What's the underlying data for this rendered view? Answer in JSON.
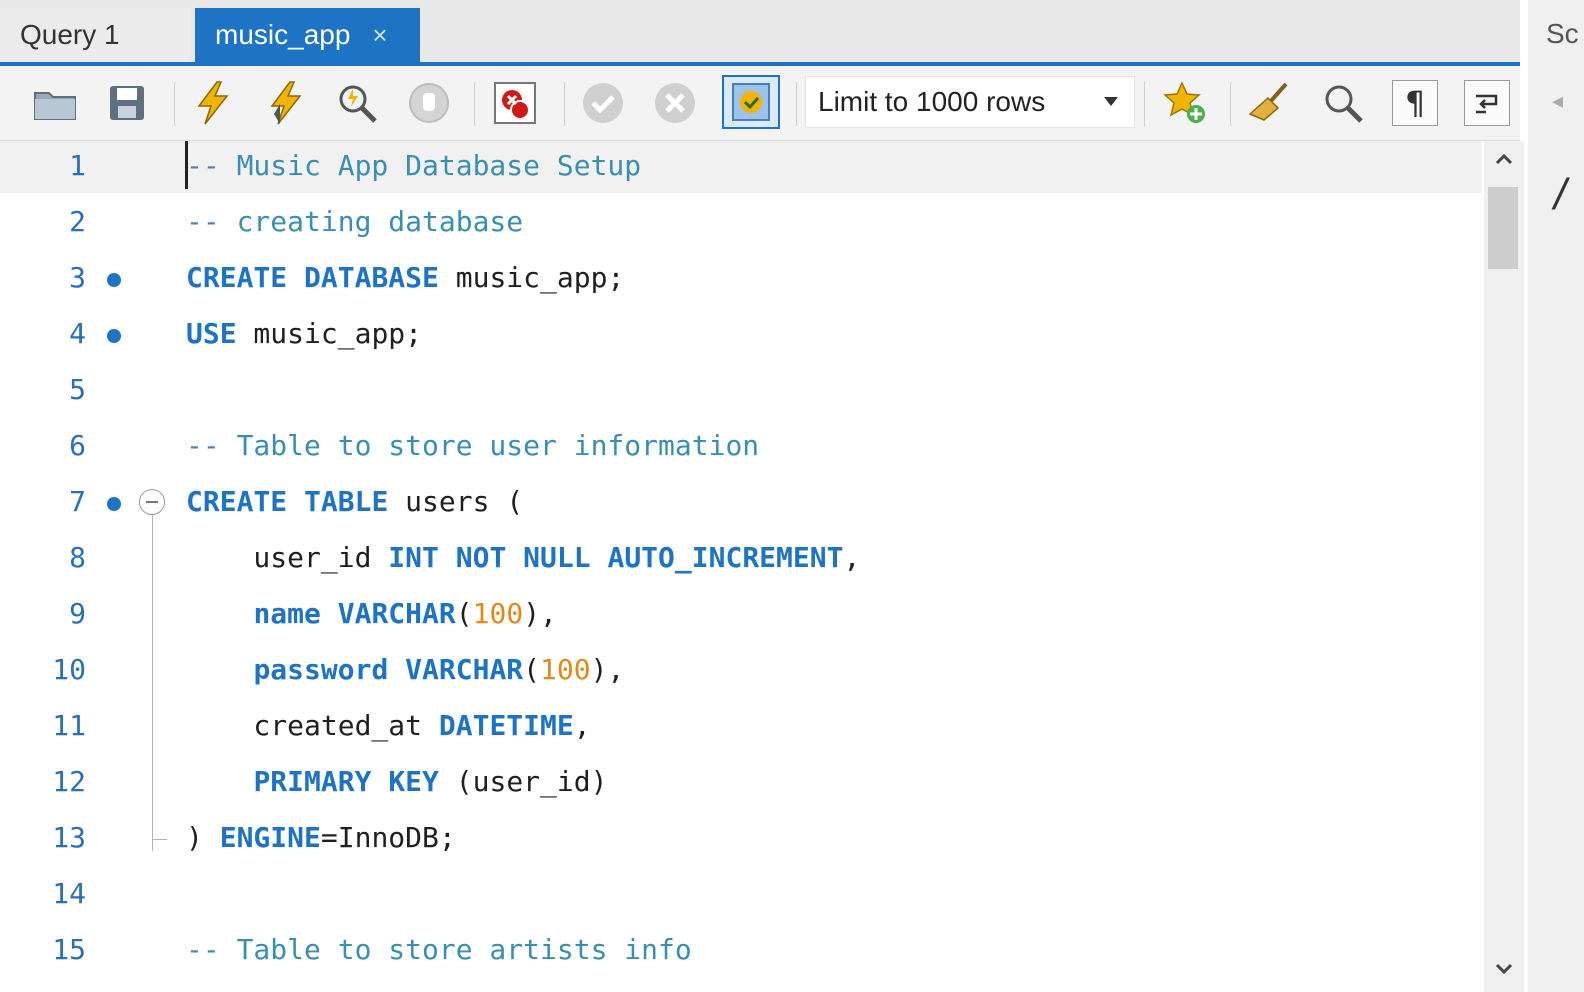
{
  "tabs": [
    {
      "label": "Query 1",
      "active": false
    },
    {
      "label": "music_app",
      "active": true,
      "close_glyph": "×"
    }
  ],
  "right_panel_stub": "Sc",
  "toolbar": {
    "icons": [
      "open-folder-icon",
      "save-icon",
      "execute-icon",
      "execute-current-icon",
      "explain-icon",
      "stop-icon",
      "toggle-error-stop-icon",
      "commit-icon",
      "rollback-icon",
      "autocommit-icon"
    ],
    "limit_select": "Limit to 1000 rows",
    "right_icons": [
      "add-snippet-star-icon",
      "beautify-broom-icon",
      "find-icon",
      "invisible-chars-icon",
      "word-wrap-icon"
    ]
  },
  "colors": {
    "accent": "#1e73c4",
    "comment": "#3a8fb0",
    "keyword": "#1e73c4",
    "number": "#e08a1a"
  },
  "editor": {
    "lines": [
      {
        "n": "1",
        "dot": false,
        "text": "-- Music App Database Setup"
      },
      {
        "n": "2",
        "dot": false,
        "text": "-- creating database"
      },
      {
        "n": "3",
        "dot": true,
        "text": "CREATE DATABASE music_app;"
      },
      {
        "n": "4",
        "dot": true,
        "text": "USE music_app;"
      },
      {
        "n": "5",
        "dot": false,
        "text": ""
      },
      {
        "n": "6",
        "dot": false,
        "text": "-- Table to store user information"
      },
      {
        "n": "7",
        "dot": true,
        "text": "CREATE TABLE users ("
      },
      {
        "n": "8",
        "dot": false,
        "text": "    user_id INT NOT NULL AUTO_INCREMENT,"
      },
      {
        "n": "9",
        "dot": false,
        "text": "    name VARCHAR(100),"
      },
      {
        "n": "10",
        "dot": false,
        "text": "    password VARCHAR(100),"
      },
      {
        "n": "11",
        "dot": false,
        "text": "    created_at DATETIME,"
      },
      {
        "n": "12",
        "dot": false,
        "text": "    PRIMARY KEY (user_id)"
      },
      {
        "n": "13",
        "dot": false,
        "text": ") ENGINE=InnoDB;"
      },
      {
        "n": "14",
        "dot": false,
        "text": ""
      },
      {
        "n": "15",
        "dot": false,
        "text": "-- Table to store artists info"
      }
    ]
  }
}
